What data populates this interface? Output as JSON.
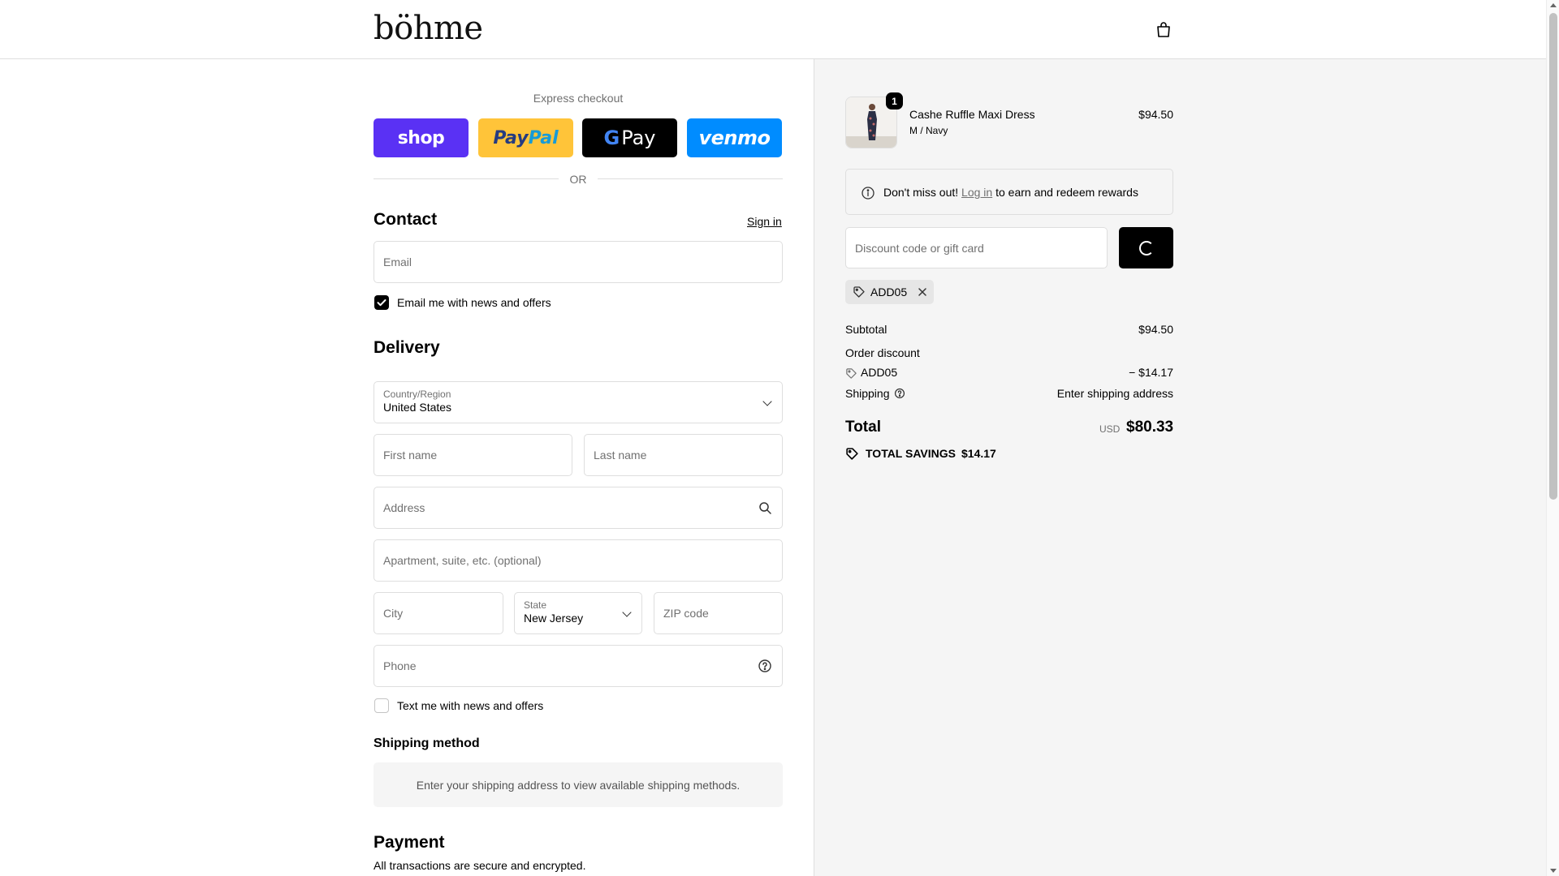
{
  "header": {
    "logo": "böhme",
    "cart_icon": "shopping-bag-icon"
  },
  "express": {
    "title": "Express checkout",
    "buttons": {
      "shop": "shop",
      "paypal_a": "Pay",
      "paypal_b": "Pal",
      "gpay_g": "G",
      "gpay": "Pay",
      "venmo": "venmo"
    },
    "or": "OR"
  },
  "contact": {
    "title": "Contact",
    "sign_in": "Sign in",
    "email_placeholder": "Email",
    "news_label": "Email me with news and offers",
    "news_checked": true
  },
  "delivery": {
    "title": "Delivery",
    "country_label": "Country/Region",
    "country_value": "United States",
    "first_name": "First name",
    "last_name": "Last name",
    "address": "Address",
    "apartment": "Apartment, suite, etc. (optional)",
    "city": "City",
    "state_label": "State",
    "state_value": "New Jersey",
    "zip": "ZIP code",
    "phone": "Phone",
    "text_label": "Text me with news and offers",
    "text_checked": false
  },
  "shipping_method": {
    "title": "Shipping method",
    "notice": "Enter your shipping address to view available shipping methods."
  },
  "payment": {
    "title": "Payment",
    "subtitle": "All transactions are secure and encrypted."
  },
  "summary": {
    "item": {
      "name": "Cashe Ruffle Maxi Dress",
      "variant": "M / Navy",
      "price": "$94.50",
      "quantity": "1"
    },
    "rewards": {
      "prefix": "Don't miss out!",
      "link": "Log in",
      "suffix": "to earn and redeem rewards"
    },
    "discount_placeholder": "Discount code or gift card",
    "applied_code": "ADD05",
    "subtotal_label": "Subtotal",
    "subtotal": "$94.50",
    "order_discount_label": "Order discount",
    "discount_code": "ADD05",
    "discount_amount": "− $14.17",
    "shipping_label": "Shipping",
    "shipping_value": "Enter shipping address",
    "total_label": "Total",
    "currency": "USD",
    "total": "$80.33",
    "savings_label": "TOTAL SAVINGS",
    "savings": "$14.17"
  },
  "colors": {
    "shop": "#5a31f4",
    "paypal": "#ffc439",
    "gpay": "#000000",
    "venmo": "#008cff"
  }
}
